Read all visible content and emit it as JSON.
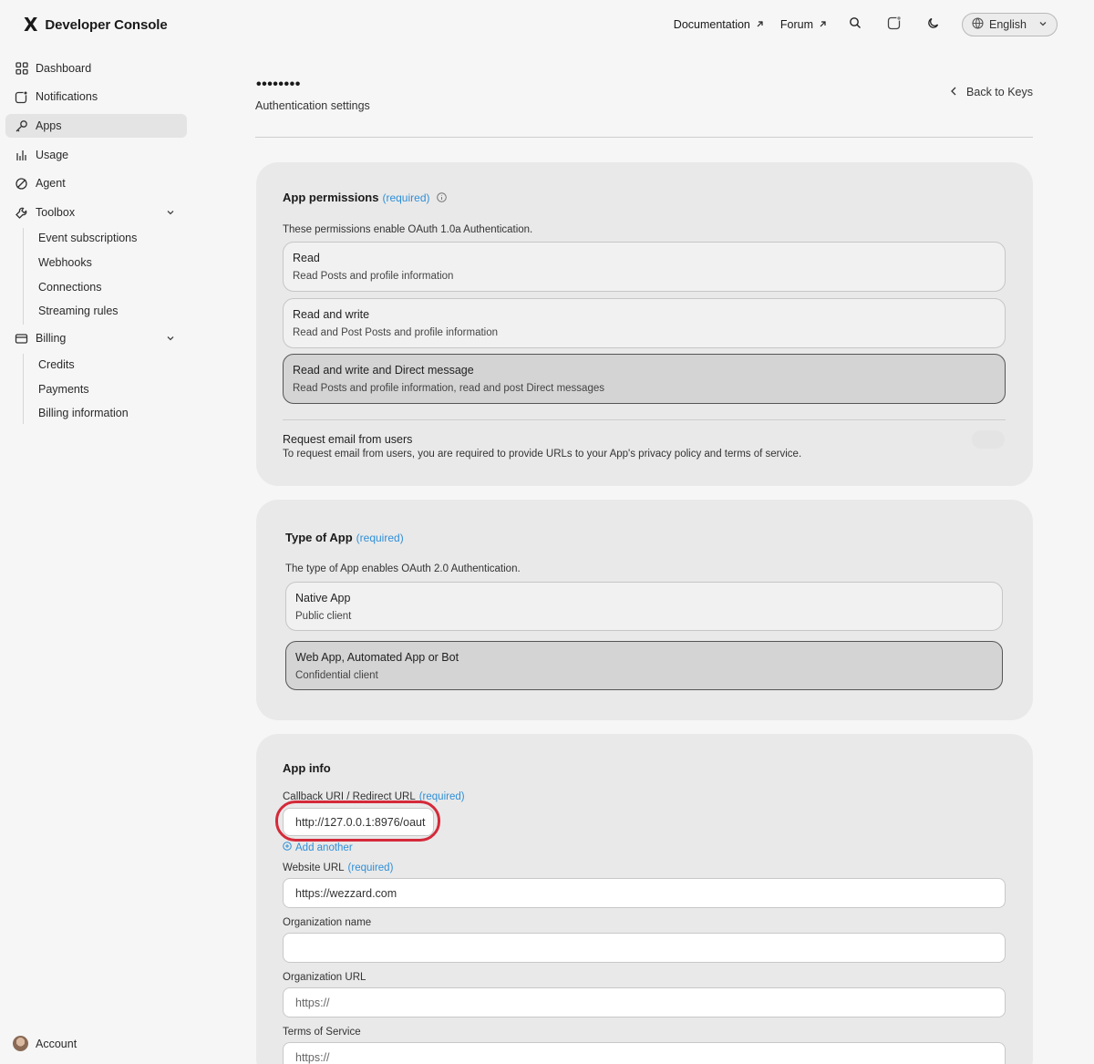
{
  "brand": {
    "logo": "X",
    "title": "Developer Console"
  },
  "nav": {
    "dashboard": "Dashboard",
    "notifications": "Notifications",
    "apps": "Apps",
    "usage": "Usage",
    "agent": "Agent",
    "toolbox": "Toolbox",
    "toolbox_items": [
      "Event subscriptions",
      "Webhooks",
      "Connections",
      "Streaming rules"
    ],
    "billing": "Billing",
    "billing_items": [
      "Credits",
      "Payments",
      "Billing information"
    ],
    "account": "Account"
  },
  "topbar": {
    "documentation": "Documentation",
    "forum": "Forum",
    "language": "English",
    "icons": [
      "arrow-up-right-icon",
      "search-icon",
      "notification-icon",
      "moon-icon",
      "globe-icon",
      "chevron-down-icon"
    ]
  },
  "header": {
    "app_name": "••••••••",
    "subtitle": "Authentication settings",
    "back_label": "Back to Keys"
  },
  "permissions": {
    "title": "App permissions",
    "required": "(required)",
    "description": "These permissions enable OAuth 1.0a Authentication.",
    "options": [
      {
        "title": "Read",
        "subtitle": "Read Posts and profile information",
        "selected": false
      },
      {
        "title": "Read and write",
        "subtitle": "Read and Post Posts and profile information",
        "selected": false
      },
      {
        "title": "Read and write and Direct message",
        "subtitle": "Read Posts and profile information, read and post Direct messages",
        "selected": true
      }
    ],
    "email_title": "Request email from users",
    "email_desc": "To request email from users, you are required to provide URLs to your App's privacy policy and terms of service."
  },
  "app_type": {
    "title": "Type of App",
    "required": "(required)",
    "description": "The type of App enables OAuth 2.0 Authentication.",
    "options": [
      {
        "title": "Native App",
        "subtitle": "Public client",
        "selected": false
      },
      {
        "title": "Web App, Automated App or Bot",
        "subtitle": "Confidential client",
        "selected": true
      }
    ]
  },
  "app_info": {
    "title": "App info",
    "callback_label": "Callback URI / Redirect URL",
    "callback_required": "(required)",
    "callback_value": "http://127.0.0.1:8976/oaut",
    "add_another": "Add another",
    "website_label": "Website URL",
    "website_required": "(required)",
    "website_value": "https://wezzard.com",
    "org_name_label": "Organization name",
    "org_name_value": "",
    "org_url_label": "Organization URL",
    "org_url_placeholder": "https://",
    "tos_label": "Terms of Service",
    "tos_placeholder": "https://"
  },
  "colors": {
    "accent": "#2f8fd8",
    "highlight": "#d42a3a",
    "card_bg": "#e9e9e9",
    "page_bg": "#f6f6f6"
  }
}
